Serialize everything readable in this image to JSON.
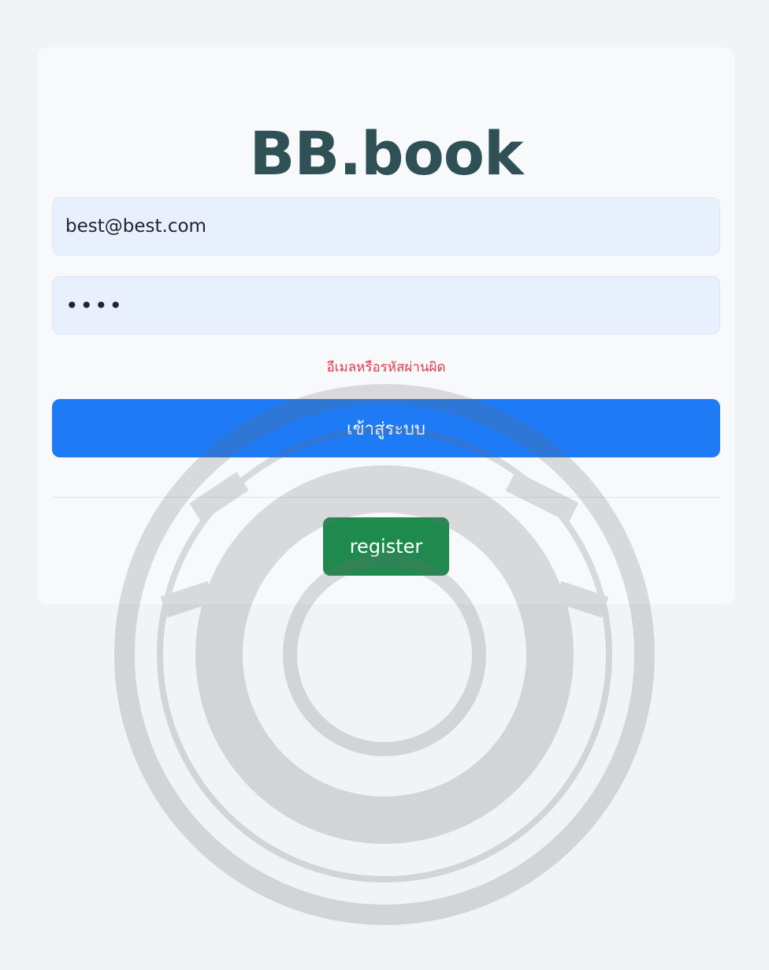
{
  "app": {
    "title": "BB.book"
  },
  "login_form": {
    "email_value": "best@best.com",
    "password_value": "••••",
    "error_message": "อีเมลหรือรหัสผ่านผิด",
    "login_label": "เข้าสู่ระบบ",
    "register_label": "register"
  },
  "colors": {
    "brand_title": "#2f5055",
    "primary_button": "#1f7bf5",
    "register_button": "#1f8a4e",
    "error_text": "#d83a4a"
  },
  "watermark": {
    "icon": "university-seal-watermark"
  }
}
